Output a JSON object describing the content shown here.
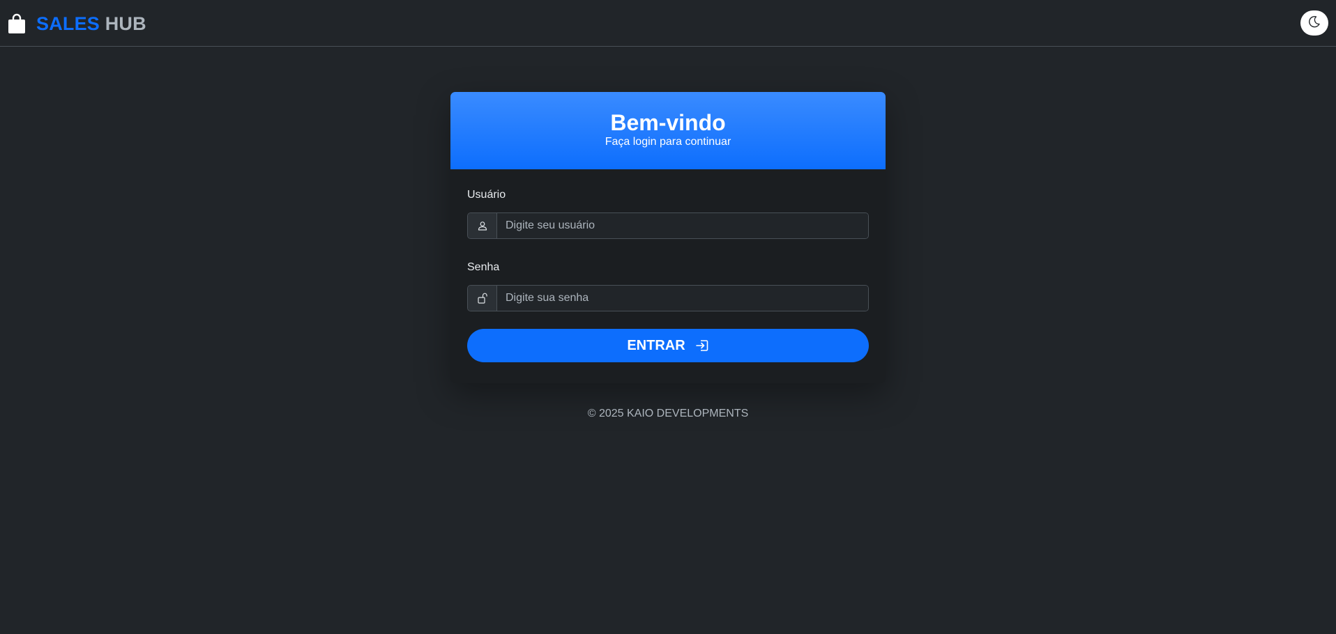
{
  "navbar": {
    "brand_icon": "shopping-bag-icon",
    "brand_part1": "SALES",
    "brand_part2": "HUB",
    "theme_toggle_icon": "moon-icon"
  },
  "login": {
    "title": "Bem-vindo",
    "subtitle": "Faça login para continuar",
    "username": {
      "label": "Usuário",
      "placeholder": "Digite seu usuário",
      "value": "",
      "icon": "user-icon"
    },
    "password": {
      "label": "Senha",
      "placeholder": "Digite sua senha",
      "value": "",
      "icon": "unlock-icon"
    },
    "submit_label": "ENTRAR",
    "submit_icon": "sign-in-icon"
  },
  "footer": {
    "text": "© 2025 KAIO DEVELOPMENTS"
  },
  "colors": {
    "background": "#212529",
    "accent": "#0d6efd",
    "card": "#1b1e21",
    "muted": "#adb5bd"
  }
}
